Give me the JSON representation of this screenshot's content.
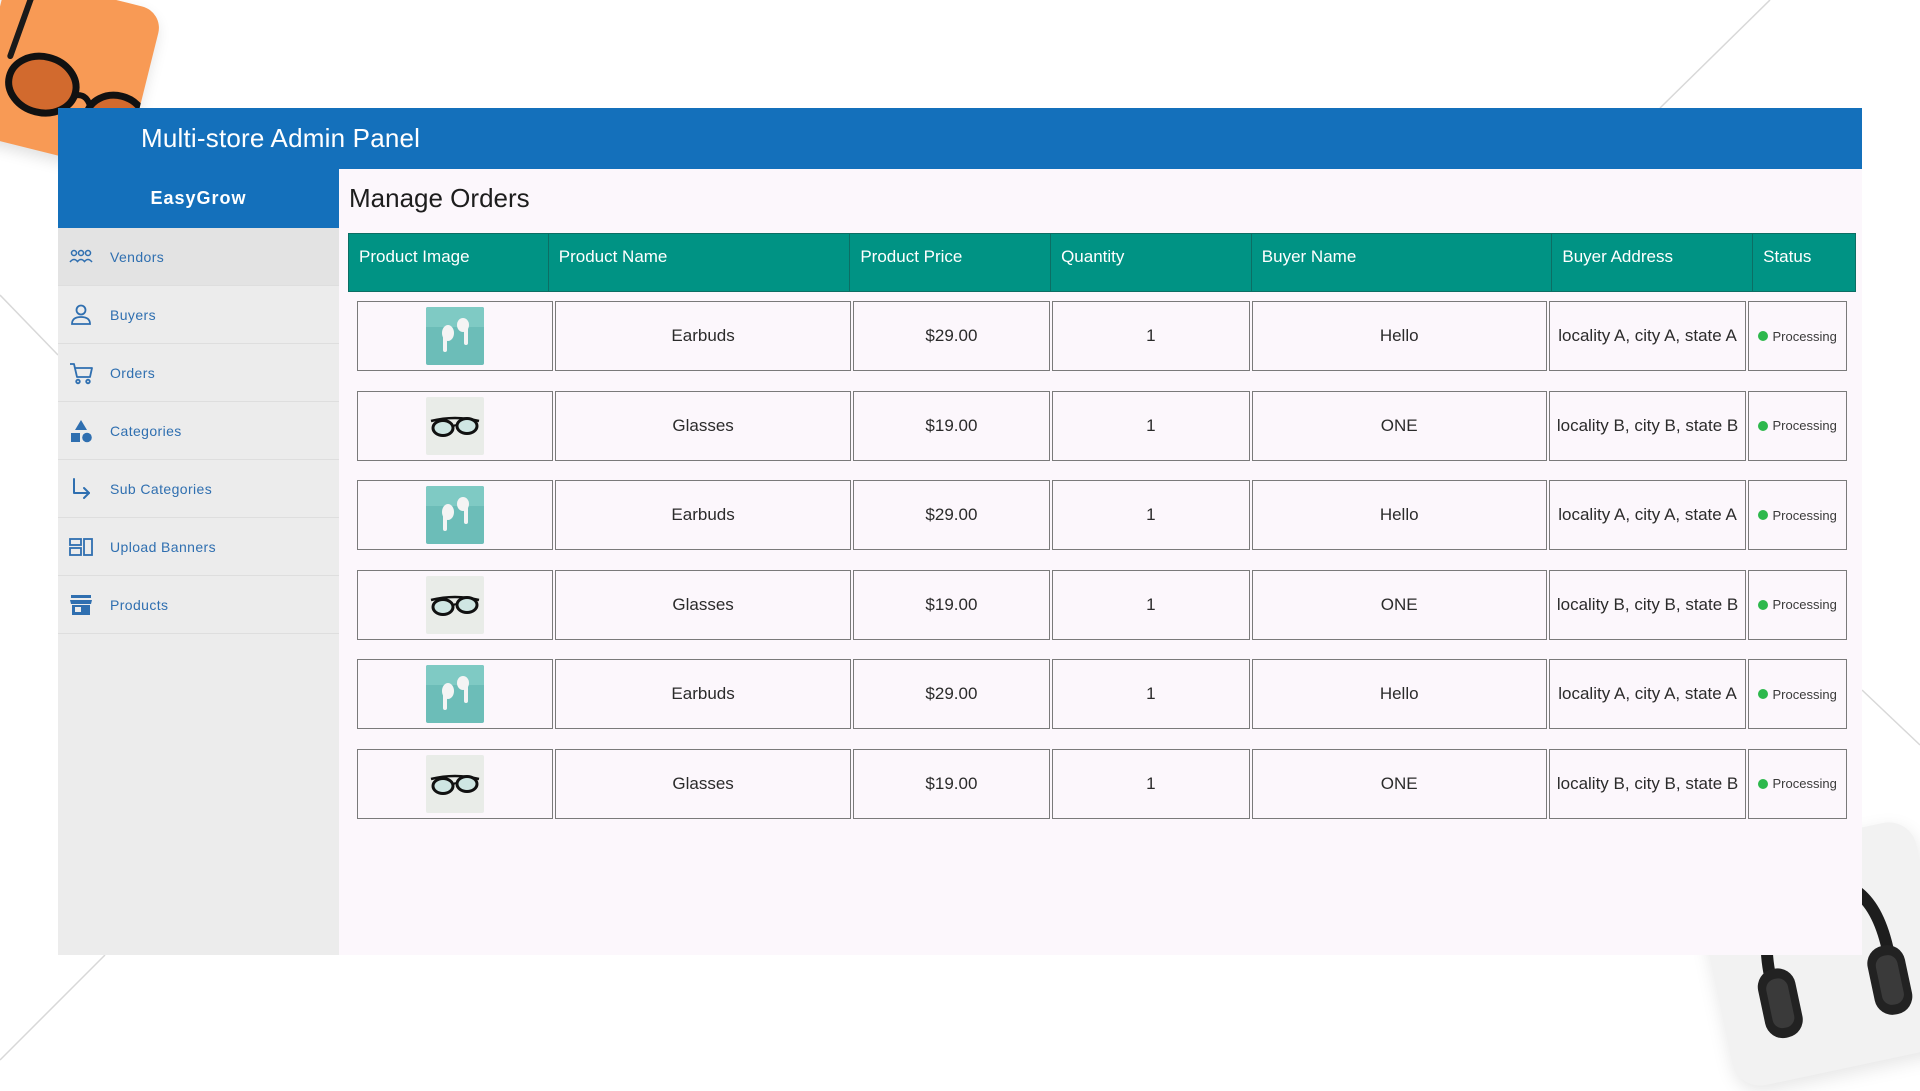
{
  "app": {
    "title": "Multi-store Admin Panel",
    "brand": "EasyGrow"
  },
  "colors": {
    "primary": "#1470bb",
    "table_header": "#009384",
    "status_ok": "#2db84c",
    "nav_text": "#2f6fb0"
  },
  "sidebar": {
    "items": [
      {
        "label": "Vendors",
        "icon": "people-group-icon",
        "active": true
      },
      {
        "label": "Buyers",
        "icon": "person-icon",
        "active": false
      },
      {
        "label": "Orders",
        "icon": "cart-icon",
        "active": false
      },
      {
        "label": "Categories",
        "icon": "shapes-icon",
        "active": false
      },
      {
        "label": "Sub Categories",
        "icon": "subdirectory-arrow-icon",
        "active": false
      },
      {
        "label": "Upload Banners",
        "icon": "banner-icon",
        "active": false
      },
      {
        "label": "Products",
        "icon": "store-icon",
        "active": false
      }
    ]
  },
  "main": {
    "title": "Manage Orders",
    "columns": [
      "Product Image",
      "Product Name",
      "Product Price",
      "Quantity",
      "Buyer Name",
      "Buyer Address",
      "Status"
    ],
    "orders": [
      {
        "image": "earbuds-thumbnail",
        "name": "Earbuds",
        "price": "$29.00",
        "qty": "1",
        "buyer": "Hello",
        "address": "locality A, city A, state A",
        "status": "Processing"
      },
      {
        "image": "glasses-thumbnail",
        "name": "Glasses",
        "price": "$19.00",
        "qty": "1",
        "buyer": "ONE",
        "address": "locality B, city B, state B",
        "status": "Processing"
      },
      {
        "image": "earbuds-thumbnail",
        "name": "Earbuds",
        "price": "$29.00",
        "qty": "1",
        "buyer": "Hello",
        "address": "locality A, city A, state A",
        "status": "Processing"
      },
      {
        "image": "glasses-thumbnail",
        "name": "Glasses",
        "price": "$19.00",
        "qty": "1",
        "buyer": "ONE",
        "address": "locality B, city B, state B",
        "status": "Processing"
      },
      {
        "image": "earbuds-thumbnail",
        "name": "Earbuds",
        "price": "$29.00",
        "qty": "1",
        "buyer": "Hello",
        "address": "locality A, city A, state A",
        "status": "Processing"
      },
      {
        "image": "glasses-thumbnail",
        "name": "Glasses",
        "price": "$19.00",
        "qty": "1",
        "buyer": "ONE",
        "address": "locality B, city B, state B",
        "status": "Processing"
      }
    ]
  }
}
